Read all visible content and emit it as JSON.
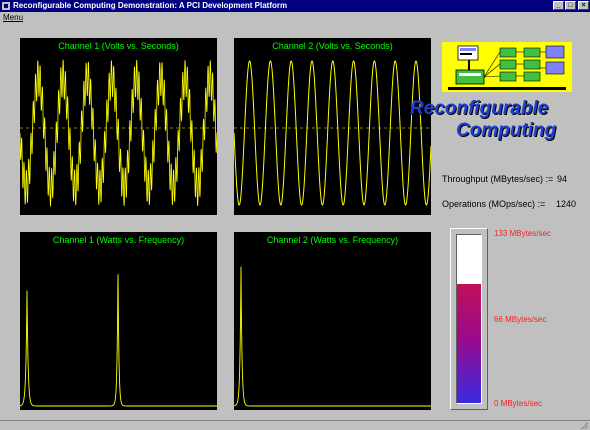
{
  "window": {
    "title": "Reconfigurable Computing Demonstration:  A PCI Development Platform",
    "buttons": {
      "minimize": "_",
      "maximize": "□",
      "close": "×"
    }
  },
  "menu": {
    "label": "Menu"
  },
  "panels": {
    "ch1_time": {
      "title": "Channel 1 (Volts vs. Seconds)"
    },
    "ch2_time": {
      "title": "Channel 2 (Volts vs. Seconds)"
    },
    "ch1_freq": {
      "title": "Channel 1 (Watts vs. Frequency)"
    },
    "ch2_freq": {
      "title": "Channel 2 (Watts vs. Frequency)"
    }
  },
  "logo": {
    "line1": "Reconfigurable",
    "line2": "Computing"
  },
  "stats": {
    "throughput_label": "Throughput (MBytes/sec) :=",
    "throughput_value": "94",
    "operations_label": "Operations (MOps/sec) :=",
    "operations_value": "1240"
  },
  "meter": {
    "max_label": "133  MBytes/sec",
    "mid_label": "66  MBytes/sec",
    "min_label": "0  MBytes/sec",
    "max_value": 133,
    "value": 94
  },
  "colors": {
    "trace": "#ffff00",
    "panel_title": "#00ff00",
    "meter_label": "#ff2020",
    "logo_text": "#1e3fd0"
  }
}
